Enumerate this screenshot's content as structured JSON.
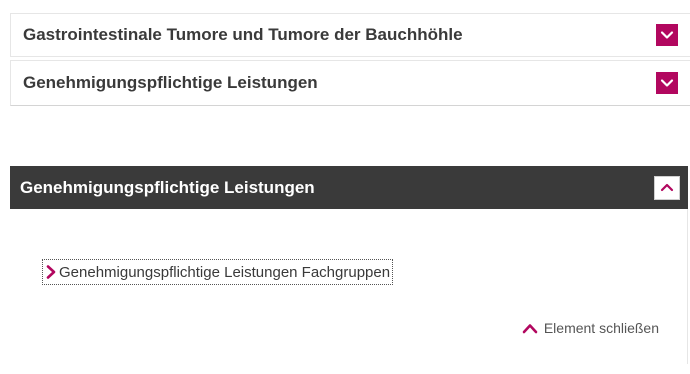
{
  "accordion": {
    "collapsed_items": [
      {
        "title": "Gastrointestinale Tumore und Tumore der Bauchhöhle",
        "toggle_icon": "chevron-down-icon"
      },
      {
        "title": "Genehmigungspflichtige Leistungen",
        "toggle_icon": "chevron-down-icon"
      }
    ],
    "expanded_item": {
      "title": "Genehmigungspflichtige Leistungen",
      "toggle_icon": "chevron-up-icon",
      "links": [
        {
          "label": "Genehmigungspflichtige Leistungen Fachgruppen",
          "icon": "chevron-right-icon"
        }
      ],
      "close_label": "Element schließen",
      "close_icon": "chevron-up-icon"
    }
  },
  "colors": {
    "accent": "#b2075f",
    "header_bg": "#3a3a3a",
    "text": "#3a3a3a"
  }
}
